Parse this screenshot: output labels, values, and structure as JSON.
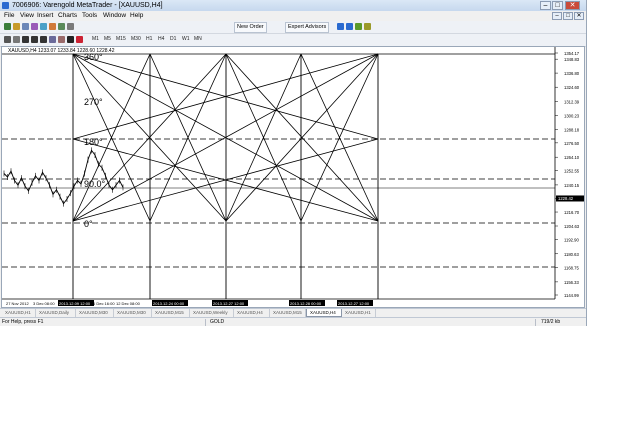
{
  "window": {
    "title": "7006906: Varengold MetaTrader - [XAUUSD,H4]",
    "minimize_label": "–",
    "restore_label": "□",
    "close_label": "✕"
  },
  "menu": {
    "items": [
      "File",
      "View",
      "Insert",
      "Charts",
      "Tools",
      "Window",
      "Help"
    ]
  },
  "toolbar": {
    "new_order_label": "New Order",
    "expert_advisors_label": "Expert Advisors",
    "timeframes": [
      "M1",
      "M5",
      "M15",
      "M30",
      "H1",
      "H4",
      "D1",
      "W1",
      "MN"
    ]
  },
  "chart": {
    "header": "XAUUSD,H4 1233.07 1233.84 1228.60 1228.42",
    "time_labels": [
      "27 Nov 2012",
      "3 Dec 08:00",
      "2013.12.09 12:00",
      "6 Dec 16:00",
      "12 Dec 08:00",
      "2013.12.24 00:00",
      "2013.12.27 12:00",
      "2013.12.28 00:00",
      "2013.12.27 12:00"
    ],
    "angle_labels": [
      "360°",
      "270°",
      "180°",
      "90.0°",
      "0°"
    ],
    "price_labels": [
      "1354.17",
      "1348.83",
      "1336.80",
      "1324.60",
      "1312.39",
      "1300.23",
      "1288.18",
      "1276.50",
      "1264.10",
      "1252.55",
      "1240.15",
      "1228.60",
      "1216.70",
      "1204.63",
      "1192.90",
      "1180.63",
      "1168.75",
      "1156.33",
      "1144.99"
    ],
    "current_price": "1228.42"
  },
  "chart_data": {
    "type": "line",
    "title": "XAUUSD,H4",
    "xlabel": "",
    "ylabel": "",
    "ylim": [
      1144.99,
      1354.17
    ],
    "series": [
      {
        "name": "XAUUSD",
        "values": [
          1250,
          1247,
          1252,
          1244,
          1240,
          1246,
          1239,
          1235,
          1242,
          1248,
          1244,
          1251,
          1246,
          1240,
          1232,
          1236,
          1230,
          1224,
          1228,
          1233,
          1239,
          1244,
          1241,
          1250,
          1262,
          1270,
          1266,
          1258,
          1255,
          1248,
          1240,
          1236,
          1240,
          1244,
          1238
        ]
      }
    ],
    "grid": false
  },
  "tabs": {
    "items": [
      "XAUUSD,H1",
      "XAUUSD,Daily",
      "XAUUSD,M30",
      "XAUUSD,M30",
      "XAUUSD,M15",
      "XAUUSD,Weekly",
      "XAUUSD,H4",
      "XAUUSD,M15",
      "XAUUSD,H4",
      "XAUUSD,H1"
    ],
    "active_index": 8
  },
  "status": {
    "help": "For Help, press F1",
    "profile": "GOLD",
    "traffic": "719/2 kb"
  },
  "colors": {
    "titlebar": "#c6d8ee",
    "accent": "#2a6ad0",
    "chart_line": "#000000"
  }
}
